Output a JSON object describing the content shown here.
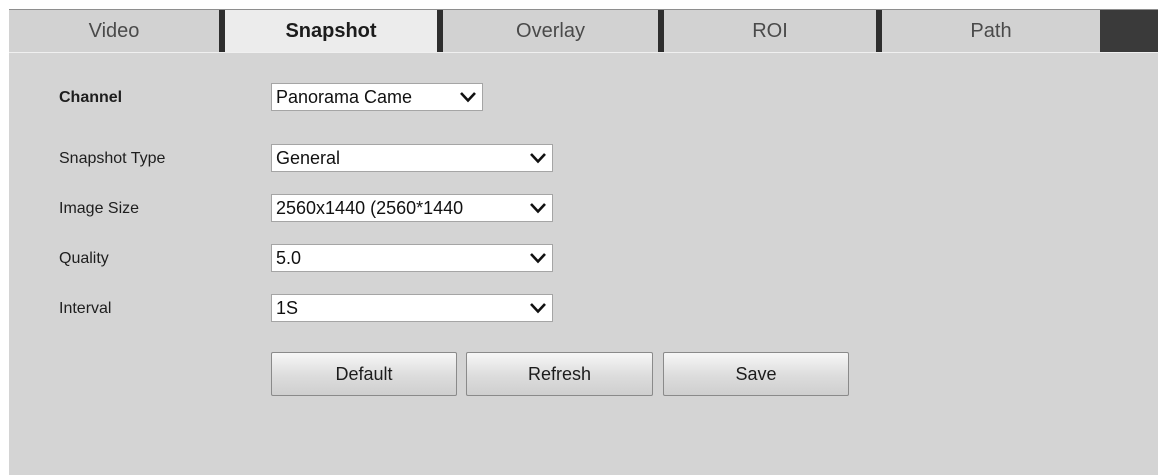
{
  "tabs": [
    {
      "label": "Video",
      "active": false
    },
    {
      "label": "Snapshot",
      "active": true
    },
    {
      "label": "Overlay",
      "active": false
    },
    {
      "label": "ROI",
      "active": false
    },
    {
      "label": "Path",
      "active": false
    }
  ],
  "form": {
    "channel": {
      "label": "Channel",
      "value": "Panorama Came"
    },
    "snapshot_type": {
      "label": "Snapshot Type",
      "value": "General"
    },
    "image_size": {
      "label": "Image Size",
      "value": "2560x1440 (2560*1440"
    },
    "quality": {
      "label": "Quality",
      "value": "5.0"
    },
    "interval": {
      "label": "Interval",
      "value": "1S"
    }
  },
  "buttons": {
    "default": "Default",
    "refresh": "Refresh",
    "save": "Save"
  },
  "icons": {
    "dropdown": "chevron-down-icon"
  }
}
